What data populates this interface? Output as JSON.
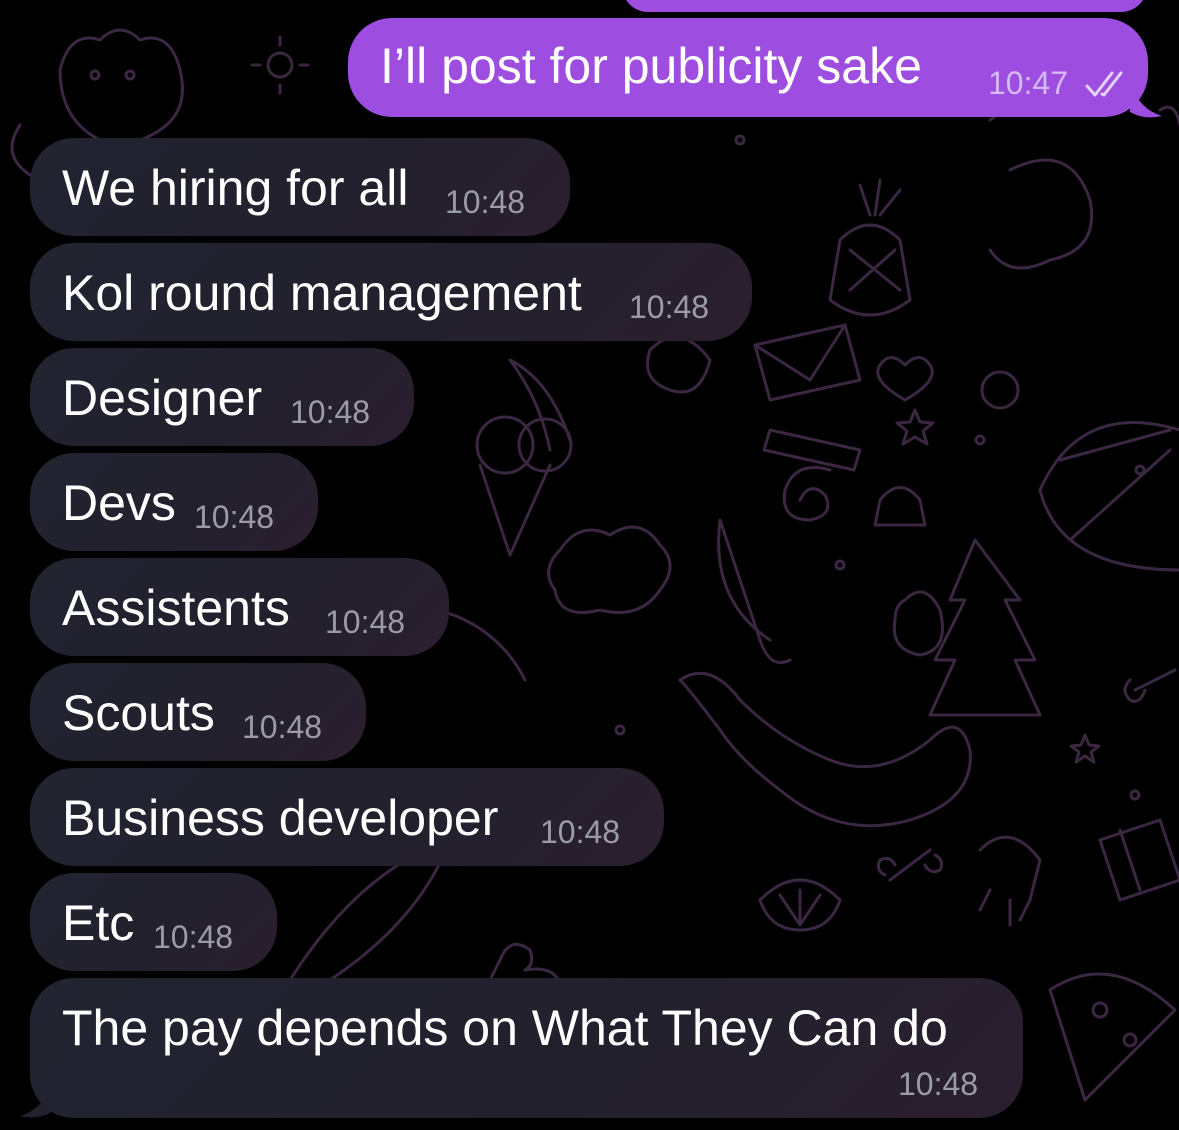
{
  "outgoing_message": {
    "text": "I’ll post for publicity sake",
    "time": "10:47",
    "status": "double-check-read-icon"
  },
  "incoming_messages": [
    {
      "text": "We hiring for all",
      "time": "10:48"
    },
    {
      "text": "Kol round management",
      "time": "10:48"
    },
    {
      "text": "Designer",
      "time": "10:48"
    },
    {
      "text": "Devs",
      "time": "10:48"
    },
    {
      "text": "Assistents",
      "time": "10:48"
    },
    {
      "text": "Scouts",
      "time": "10:48"
    },
    {
      "text": "Business developer",
      "time": "10:48"
    },
    {
      "text": "Etc",
      "time": "10:48"
    },
    {
      "text": "The pay depends on What They Can do",
      "time": "10:48"
    }
  ],
  "colors": {
    "background": "#000000",
    "outgoing_bubble": "#9d4ee0",
    "incoming_bubble": "#232330",
    "doodle": "#3a2840"
  }
}
